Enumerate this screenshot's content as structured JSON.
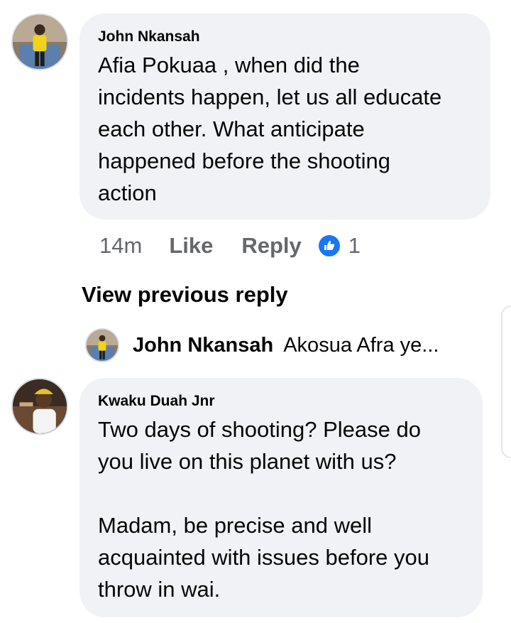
{
  "comments": [
    {
      "author": "John Nkansah",
      "text": "Afia Pokuaa , when did the\nincidents happen, let us all educate\neach other. What anticipate\nhappened before the shooting\naction",
      "avatar_icon": "profile-photo-man-yellow-shirt"
    },
    {
      "author": "Kwaku Duah Jnr",
      "text": "Two days of shooting? Please do\nyou live on this planet with us?\n\nMadam, be precise and well\nacquainted with issues before you\nthrow in wai.",
      "avatar_icon": "profile-photo-man-cap"
    }
  ],
  "actions": {
    "time": "14m",
    "like": "Like",
    "reply": "Reply",
    "reaction_count": "1",
    "reaction_icon": "thumbs-up-icon"
  },
  "view_previous": "View previous reply",
  "reply_preview": {
    "author": "John Nkansah",
    "snippet": "Akosua Afra ye..."
  },
  "colors": {
    "bubble": "#f0f2f5",
    "meta_text": "#65676b",
    "like_blue": "#1877f2",
    "text": "#050505"
  }
}
